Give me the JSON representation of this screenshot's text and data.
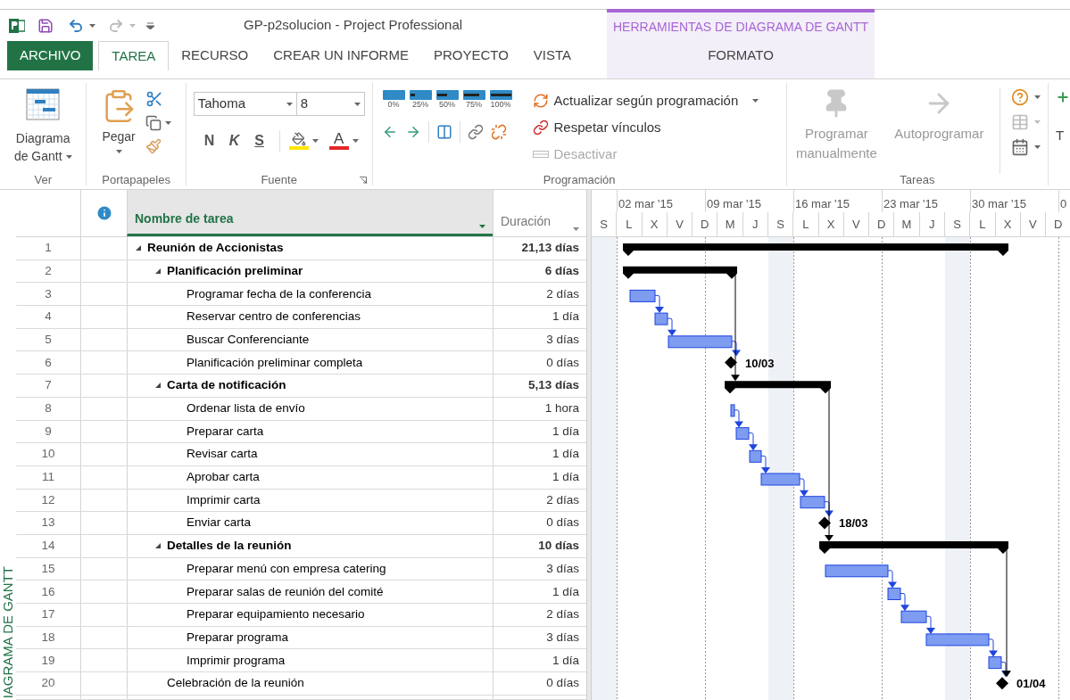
{
  "title_bar": {
    "title": "GP-p2solucion - Project Professional",
    "contextual_group": "HERRAMIENTAS DE DIAGRAMA DE GANTT",
    "undo": {
      "disabled": false
    },
    "redo": {
      "disabled": true
    }
  },
  "tabs": [
    {
      "label": "ARCHIVO",
      "kind": "file",
      "selected": false
    },
    {
      "label": "TAREA",
      "kind": "normal",
      "selected": true
    },
    {
      "label": "RECURSO",
      "kind": "normal",
      "selected": false
    },
    {
      "label": "CREAR UN INFORME",
      "kind": "normal",
      "selected": false
    },
    {
      "label": "PROYECTO",
      "kind": "normal",
      "selected": false
    },
    {
      "label": "VISTA",
      "kind": "normal",
      "selected": false
    },
    {
      "label": "FORMATO",
      "kind": "contextual",
      "selected": false
    }
  ],
  "ribbon": {
    "view_group": {
      "label": "Ver",
      "button": {
        "label": "Diagrama de Gantt",
        "has_menu": true
      }
    },
    "clipboard_group": {
      "label": "Portapapeles",
      "paste_button": {
        "label": "Pegar",
        "has_menu": true
      }
    },
    "font_group": {
      "label": "Fuente",
      "font_name": "Tahoma",
      "font_size": "8",
      "style_buttons": [
        {
          "label": "N",
          "kind": "bold"
        },
        {
          "label": "K",
          "kind": "italic"
        },
        {
          "label": "S",
          "kind": "underline"
        }
      ],
      "font_color_label": "A"
    },
    "schedule_group": {
      "label": "Programación",
      "percent_buttons": [
        {
          "label": "0%",
          "level": 0
        },
        {
          "label": "25%",
          "level": 0.25
        },
        {
          "label": "50%",
          "level": 0.5
        },
        {
          "label": "75%",
          "level": 0.75
        },
        {
          "label": "100%",
          "level": 1
        }
      ],
      "commands": [
        {
          "label": "Actualizar según programación",
          "has_menu": true,
          "disabled": false
        },
        {
          "label": "Respetar vínculos",
          "has_menu": false,
          "disabled": false
        },
        {
          "label": "Desactivar",
          "has_menu": false,
          "disabled": true
        }
      ]
    },
    "tasks_group": {
      "label": "Tareas",
      "buttons": [
        {
          "label": "Programar manualmente",
          "disabled": true
        },
        {
          "label": "Autoprogramar",
          "disabled": true
        }
      ]
    },
    "cut_off_group": {
      "label": "T"
    }
  },
  "view_label": "IAGRAMA DE GANTT",
  "grid": {
    "columns": [
      {
        "label": "Nombre de tarea",
        "selected": true
      },
      {
        "label": "Duración",
        "selected": false
      }
    ],
    "tasks": [
      {
        "id": "1",
        "name": "Reunión de Accionistas",
        "duration": "21,13 días",
        "kind": "summary",
        "expanded": true,
        "children": [
          {
            "id": "2",
            "name": "Planificación preliminar",
            "duration": "6 días",
            "kind": "summary",
            "expanded": true,
            "children": [
              {
                "id": "3",
                "name": "Programar fecha de la conferencia",
                "duration": "2 días",
                "kind": "task"
              },
              {
                "id": "4",
                "name": "Reservar centro de conferencias",
                "duration": "1 día",
                "kind": "task"
              },
              {
                "id": "5",
                "name": "Buscar Conferenciante",
                "duration": "3 días",
                "kind": "task"
              },
              {
                "id": "6",
                "name": "Planificación preliminar completa",
                "duration": "0 días",
                "kind": "milestone",
                "bar_label": "10/03"
              }
            ]
          },
          {
            "id": "7",
            "name": "Carta de notificación",
            "duration": "5,13 días",
            "kind": "summary",
            "expanded": true,
            "children": [
              {
                "id": "8",
                "name": "Ordenar lista de envío",
                "duration": "1 hora",
                "kind": "task"
              },
              {
                "id": "9",
                "name": "Preparar carta",
                "duration": "1 día",
                "kind": "task"
              },
              {
                "id": "10",
                "name": "Revisar carta",
                "duration": "1 día",
                "kind": "task"
              },
              {
                "id": "11",
                "name": "Aprobar carta",
                "duration": "1 día",
                "kind": "task"
              },
              {
                "id": "12",
                "name": "Imprimir carta",
                "duration": "2 días",
                "kind": "task"
              },
              {
                "id": "13",
                "name": "Enviar carta",
                "duration": "0 días",
                "kind": "milestone",
                "bar_label": "18/03"
              }
            ]
          },
          {
            "id": "14",
            "name": "Detalles de la reunión",
            "duration": "10 días",
            "kind": "summary",
            "expanded": true,
            "children": [
              {
                "id": "15",
                "name": "Preparar menú con empresa catering",
                "duration": "3 días",
                "kind": "task"
              },
              {
                "id": "16",
                "name": "Preparar salas de reunión del comité",
                "duration": "1 día",
                "kind": "task"
              },
              {
                "id": "17",
                "name": "Preparar equipamiento necesario",
                "duration": "2 días",
                "kind": "task"
              },
              {
                "id": "18",
                "name": "Preparar programa",
                "duration": "3 días",
                "kind": "task"
              },
              {
                "id": "19",
                "name": "Imprimir programa",
                "duration": "1 día",
                "kind": "task"
              }
            ]
          },
          {
            "id": "20",
            "name": "Celebración de la reunión",
            "duration": "0 días",
            "kind": "milestone",
            "bar_label": "01/04"
          }
        ]
      }
    ]
  },
  "timescale": {
    "weeks": [
      "02 mar '15",
      "09 mar '15",
      "16 mar '15",
      "23 mar '15",
      "30 mar '15",
      "0"
    ],
    "days": [
      "S",
      "L",
      "X",
      "V",
      "D",
      "M",
      "J",
      "S",
      "L",
      "X",
      "V",
      "D",
      "M",
      "J",
      "S",
      "L",
      "X",
      "V",
      "D"
    ]
  }
}
